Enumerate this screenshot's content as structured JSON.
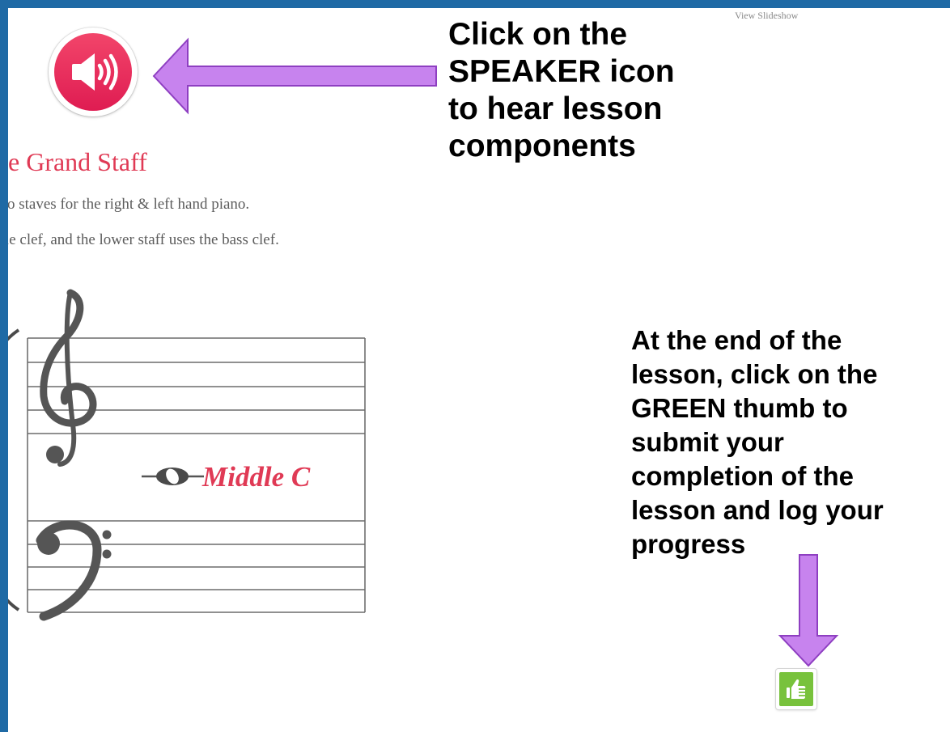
{
  "toolbar": {
    "view_slideshow": "View Slideshow"
  },
  "speaker": {
    "icon": "speaker-icon",
    "color": "#e8285a"
  },
  "instructions": {
    "speaker_text": "Click on the SPEAKER icon to hear lesson components",
    "thumb_text": "At the end of the lesson, click on the GREEN thumb to submit your completion of the lesson and log your progress"
  },
  "lesson": {
    "title": "he Grand Staff",
    "line1": "two staves for the right & left hand piano.",
    "line2": "eble clef, and the lower staff uses the bass clef.",
    "middle_c_label": "Middle C"
  },
  "thumbs_up": {
    "icon": "thumbs-up-icon",
    "color": "#78c23c"
  },
  "colors": {
    "frame": "#1f6aa5",
    "arrow": "#c783ee",
    "arrow_stroke": "#8e3fc1",
    "title": "#e03a55"
  }
}
